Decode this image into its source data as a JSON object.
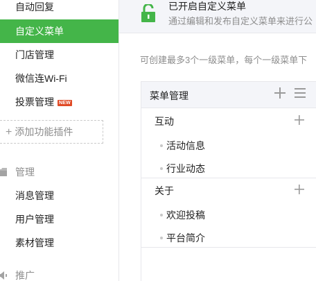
{
  "sidebar": {
    "items": [
      {
        "label": "自动回复"
      },
      {
        "label": "自定义菜单"
      },
      {
        "label": "门店管理"
      },
      {
        "label": "微信连Wi-Fi"
      },
      {
        "label": "投票管理",
        "badge": "NEW"
      }
    ],
    "add_plugin": {
      "icon": "plus-icon",
      "label": "添加功能插件"
    },
    "manage_section": {
      "icon": "folder-icon",
      "title": "管理",
      "items": [
        {
          "label": "消息管理"
        },
        {
          "label": "用户管理"
        },
        {
          "label": "素材管理"
        }
      ]
    },
    "promote_section": {
      "icon": "speaker-icon",
      "title": "推广"
    }
  },
  "status": {
    "icon": "unlock-icon",
    "title": "已开启自定义菜单",
    "subtitle": "通过编辑和发布自定义菜单来进行公"
  },
  "hint": "可创建最多3个一级菜单，每个一级菜单下",
  "menu_panel": {
    "title": "菜单管理",
    "groups": [
      {
        "label": "互动",
        "items": [
          "活动信息",
          "行业动态"
        ]
      },
      {
        "label": "关于",
        "items": [
          "欢迎投稿",
          "平台简介"
        ]
      }
    ]
  },
  "colors": {
    "accent": "#44b549",
    "badge": "#e04a26",
    "panel_bg": "#f4f5f9",
    "border": "#e7e7eb",
    "muted": "#8d8d8d"
  }
}
